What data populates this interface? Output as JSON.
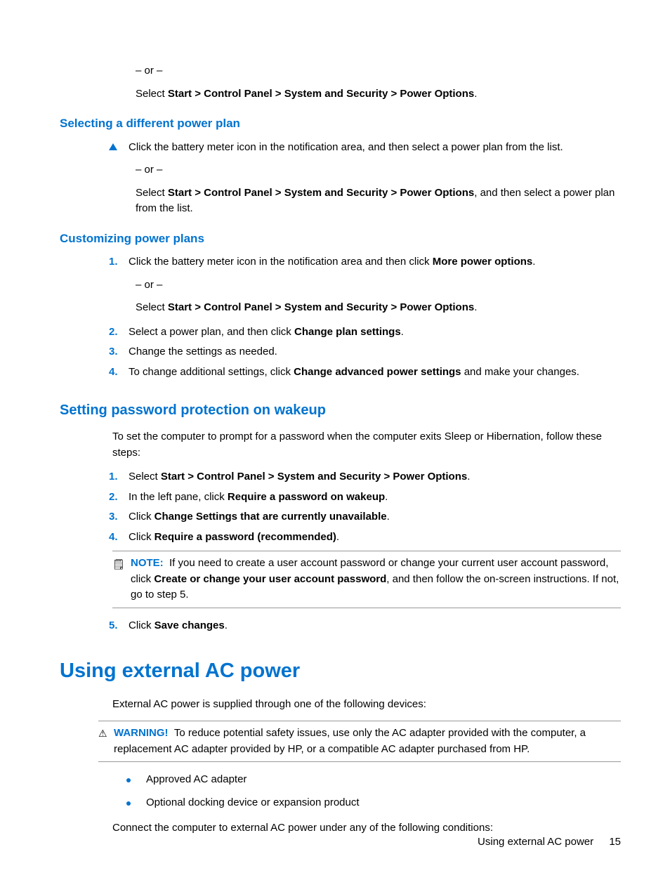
{
  "intro": {
    "or": "– or –",
    "select_prefix": "Select ",
    "nav_path": "Start > Control Panel > System and Security > Power Options",
    "period": "."
  },
  "section_select": {
    "heading": "Selecting a different power plan",
    "click_text": "Click the battery meter icon in the notification area, and then select a power plan from the list.",
    "or": "– or –",
    "select_prefix": "Select ",
    "nav_path": "Start > Control Panel > System and Security > Power Options",
    "select_suffix": ", and then select a power plan from the list."
  },
  "section_custom": {
    "heading": "Customizing power plans",
    "step1_pre": "Click the battery meter icon in the notification area and then click ",
    "step1_bold": "More power options",
    "step1_post": ".",
    "or": "– or –",
    "select_prefix": "Select ",
    "nav_path": "Start > Control Panel > System and Security > Power Options",
    "period": ".",
    "step2_pre": "Select a power plan, and then click ",
    "step2_bold": "Change plan settings",
    "step2_post": ".",
    "step3": "Change the settings as needed.",
    "step4_pre": "To change additional settings, click ",
    "step4_bold": "Change advanced power settings",
    "step4_post": " and make your changes."
  },
  "section_password": {
    "heading": "Setting password protection on wakeup",
    "intro": "To set the computer to prompt for a password when the computer exits Sleep or Hibernation, follow these steps:",
    "step1_pre": "Select ",
    "step1_bold": "Start > Control Panel > System and Security > Power Options",
    "step1_post": ".",
    "step2_pre": "In the left pane, click ",
    "step2_bold": "Require a password on wakeup",
    "step2_post": ".",
    "step3_pre": "Click ",
    "step3_bold": "Change Settings that are currently unavailable",
    "step3_post": ".",
    "step4_pre": "Click ",
    "step4_bold": "Require a password (recommended)",
    "step4_post": ".",
    "note_label": "NOTE:",
    "note_text_pre": "If you need to create a user account password or change your current user account password, click ",
    "note_text_bold": "Create or change your user account password",
    "note_text_post": ", and then follow the on-screen instructions. If not, go to step 5.",
    "step5_pre": "Click ",
    "step5_bold": "Save changes",
    "step5_post": "."
  },
  "section_ac": {
    "heading": "Using external AC power",
    "intro": "External AC power is supplied through one of the following devices:",
    "warn_label": "WARNING!",
    "warn_text": "To reduce potential safety issues, use only the AC adapter provided with the computer, a replacement AC adapter provided by HP, or a compatible AC adapter purchased from HP.",
    "bullet1": "Approved AC adapter",
    "bullet2": "Optional docking device or expansion product",
    "outro": "Connect the computer to external AC power under any of the following conditions:"
  },
  "footer": {
    "title": "Using external AC power",
    "page": "15"
  },
  "markers": {
    "n1": "1.",
    "n2": "2.",
    "n3": "3.",
    "n4": "4.",
    "n5": "5."
  }
}
